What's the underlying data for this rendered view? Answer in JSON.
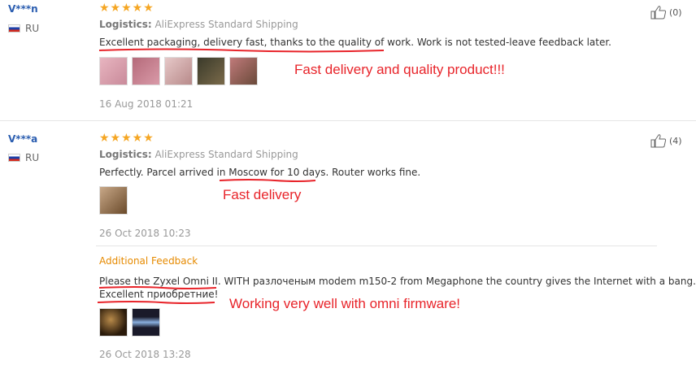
{
  "reviews": [
    {
      "user": "V***n",
      "country": "RU",
      "stars": "★★★★★",
      "logistics_label": "Logistics:",
      "logistics_value": "AliExpress Standard Shipping",
      "text": "Excellent packaging, delivery fast, thanks to the quality of work. Work is not tested-leave feedback later.",
      "annotation": "Fast delivery and quality product!!!",
      "date": "16 Aug 2018 01:21",
      "helpful": "(0)",
      "photo_colors": [
        "#c98a9a",
        "#b56a7a",
        "#d9a0a8",
        "#5a4a3a",
        "#a07060"
      ]
    },
    {
      "user": "V***a",
      "country": "RU",
      "stars": "★★★★★",
      "logistics_label": "Logistics:",
      "logistics_value": "AliExpress Standard Shipping",
      "text_a": "Perfectly. Parcel arrived ",
      "text_b": "in Moscow for 10 days",
      "text_c": ". Router works fine.",
      "annotation": "Fast delivery",
      "date": "26 Oct 2018 10:23",
      "helpful": "(4)",
      "photo_colors": [
        "#8a6a4a"
      ],
      "additional": {
        "label": "Additional Feedback",
        "line1": "Please the Zyxel Omni II. WITH разлоченым modem m150-2 from Megaphone the country gives the Internet with a bang.",
        "line2": "Excellent приобретние!",
        "annotation": "Working very well with omni firmware!",
        "date": "26 Oct 2018 13:28",
        "photo_colors": [
          "#3a2a1a",
          "#2a3a5a"
        ]
      }
    }
  ],
  "colors": {
    "annotation": "#e8242a",
    "stars": "#f5a623",
    "username": "#2a5db0",
    "additional_label": "#e68a00"
  }
}
